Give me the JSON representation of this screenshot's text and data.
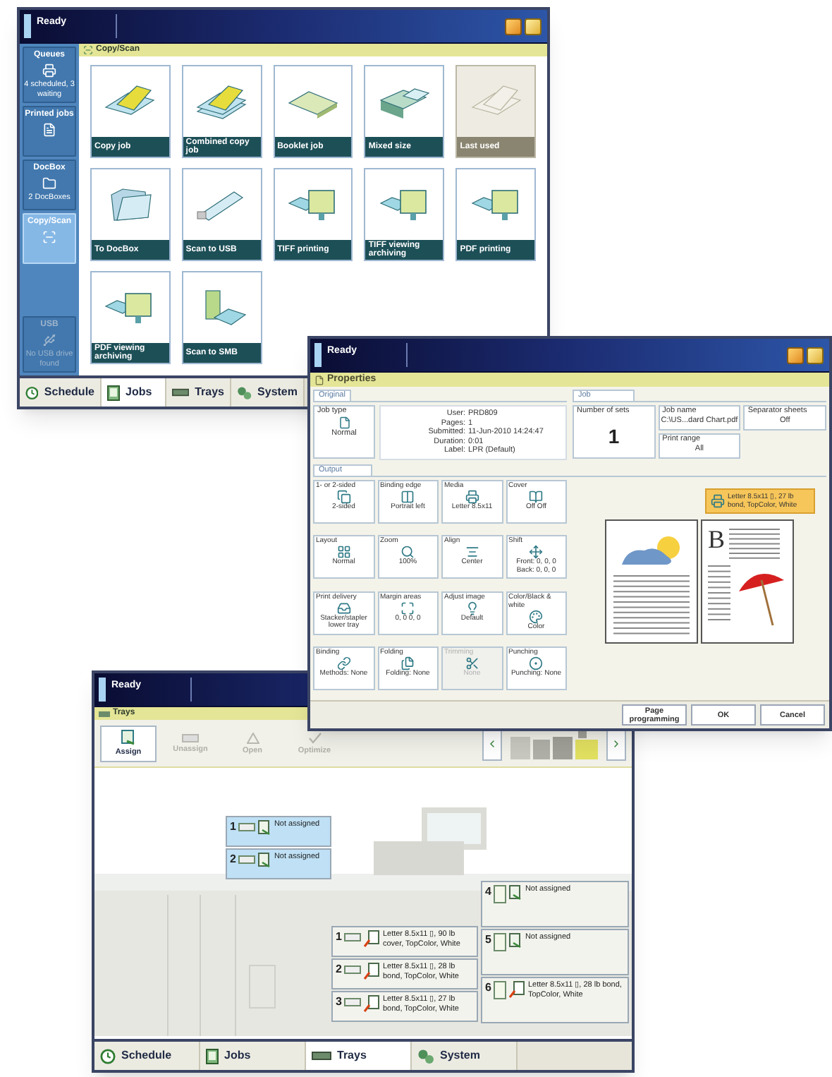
{
  "copy_scan_window": {
    "title": "Ready",
    "sidebar": [
      {
        "label": "Queues",
        "detail": "4 scheduled, 3 waiting",
        "kind": "queues",
        "selected": false,
        "disabled": false
      },
      {
        "label": "Printed jobs",
        "kind": "printed",
        "selected": false,
        "disabled": false
      },
      {
        "label": "DocBox",
        "detail": "2 DocBoxes",
        "kind": "docbox",
        "selected": false,
        "disabled": false
      },
      {
        "label": "Copy/Scan",
        "kind": "copyscan",
        "selected": true,
        "disabled": false
      },
      {
        "label": "USB",
        "detail": "No USB drive found",
        "kind": "usb",
        "selected": false,
        "disabled": true
      }
    ],
    "section_title": "Copy/Scan",
    "tiles": [
      {
        "label": "Copy job",
        "kind": "copy",
        "disabled": false
      },
      {
        "label": "Combined copy job",
        "kind": "combined",
        "disabled": false
      },
      {
        "label": "Booklet job",
        "kind": "booklet",
        "disabled": false
      },
      {
        "label": "Mixed size",
        "kind": "mixed",
        "disabled": false
      },
      {
        "label": "Last used",
        "kind": "copy",
        "disabled": true
      },
      {
        "label": "To DocBox",
        "kind": "folder",
        "disabled": false
      },
      {
        "label": "Scan to USB",
        "kind": "usb",
        "disabled": false
      },
      {
        "label": "TIFF printing",
        "kind": "scan",
        "disabled": false
      },
      {
        "label": "TIFF viewing archiving",
        "kind": "scan",
        "disabled": false
      },
      {
        "label": "PDF printing",
        "kind": "scan",
        "disabled": false
      },
      {
        "label": "PDF viewing archiving",
        "kind": "scan",
        "disabled": false
      },
      {
        "label": "Scan to SMB",
        "kind": "server",
        "disabled": false
      }
    ],
    "tabs": [
      {
        "label": "Schedule",
        "kind": "schedule",
        "selected": false
      },
      {
        "label": "Jobs",
        "kind": "jobs",
        "selected": true
      },
      {
        "label": "Trays",
        "kind": "trays",
        "selected": false
      },
      {
        "label": "System",
        "kind": "system",
        "selected": false
      }
    ]
  },
  "properties_window": {
    "title": "Ready",
    "header": "Properties",
    "original": {
      "tab": "Original",
      "job_type_label": "Job type",
      "job_type_value": "Normal",
      "info": [
        {
          "label": "User:",
          "value": "PRD809"
        },
        {
          "label": "Pages:",
          "value": "1"
        },
        {
          "label": "Submitted:",
          "value": "11-Jun-2010 14:24:47"
        },
        {
          "label": "Duration:",
          "value": "0:01"
        },
        {
          "label": "Label:",
          "value": "LPR (Default)"
        }
      ]
    },
    "job": {
      "tab": "Job",
      "sets": {
        "label": "Number of sets",
        "value": "1"
      },
      "name": {
        "label": "Job name",
        "value": "C:\\US...dard Chart.pdf"
      },
      "range": {
        "label": "Print range",
        "value": "All"
      },
      "separator": {
        "label": "Separator sheets",
        "value": "Off"
      }
    },
    "output": {
      "tab": "Output",
      "settings": [
        {
          "label": "1- or 2-sided",
          "value": "2-sided",
          "kind": "sides",
          "disabled": false
        },
        {
          "label": "Binding edge",
          "value": "Portrait left",
          "kind": "binding_edge",
          "disabled": false
        },
        {
          "label": "Media",
          "value": "Letter 8.5x11",
          "kind": "media",
          "disabled": false
        },
        {
          "label": "Cover",
          "value": "Off Off",
          "kind": "cover",
          "disabled": false
        },
        {
          "label": "Layout",
          "value": "Normal",
          "kind": "layout",
          "disabled": false
        },
        {
          "label": "Zoom",
          "value": "100%",
          "kind": "zoom",
          "disabled": false
        },
        {
          "label": "Align",
          "value": "Center",
          "kind": "align",
          "disabled": false
        },
        {
          "label": "Shift",
          "value": "Front: 0, 0, 0 Back: 0, 0, 0",
          "kind": "shift",
          "disabled": false
        },
        {
          "label": "Print delivery",
          "value": "Stacker/stapler lower tray",
          "kind": "delivery",
          "disabled": false
        },
        {
          "label": "Margin areas",
          "value": "0, 0 0, 0",
          "kind": "margin",
          "disabled": false
        },
        {
          "label": "Adjust image",
          "value": "Default",
          "kind": "adjust",
          "disabled": false
        },
        {
          "label": "Color/Black & white",
          "value": "Color",
          "kind": "color",
          "disabled": false
        },
        {
          "label": "Binding",
          "value": "Methods: None",
          "kind": "binding",
          "disabled": false
        },
        {
          "label": "Folding",
          "value": "Folding: None",
          "kind": "folding",
          "disabled": false
        },
        {
          "label": "Trimming",
          "value": "None",
          "kind": "trimming",
          "disabled": true
        },
        {
          "label": "Punching",
          "value": "Punching: None",
          "kind": "punching",
          "disabled": false
        }
      ],
      "media": "Letter 8.5x11 ▯, 27 lb bond, TopColor, White",
      "preview_letter": "B"
    },
    "buttons": [
      "Page programming",
      "OK",
      "Cancel"
    ]
  },
  "trays_window": {
    "title": "Ready",
    "header": "Trays",
    "tools": [
      {
        "label": "Assign",
        "kind": "assign",
        "selected": true,
        "disabled": false
      },
      {
        "label": "Unassign",
        "kind": "unassign",
        "selected": false,
        "disabled": true
      },
      {
        "label": "Open",
        "kind": "open",
        "selected": false,
        "disabled": true
      },
      {
        "label": "Optimize",
        "kind": "optimize",
        "selected": false,
        "disabled": true
      }
    ],
    "upper_trays": [
      {
        "number": "1",
        "text": "Not assigned",
        "assigned": false
      },
      {
        "number": "2",
        "text": "Not assigned",
        "assigned": false
      }
    ],
    "lower_trays": [
      {
        "number": "1",
        "text": "Letter 8.5x11 ▯, 90 lb cover, TopColor, White",
        "assigned": true
      },
      {
        "number": "2",
        "text": "Letter 8.5x11 ▯, 28 lb bond, TopColor, White",
        "assigned": true
      },
      {
        "number": "3",
        "text": "Letter 8.5x11 ▯, 27 lb bond, TopColor, White",
        "assigned": true
      }
    ],
    "right_trays": [
      {
        "number": "4",
        "text": "Not assigned",
        "assigned": false
      },
      {
        "number": "5",
        "text": "Not assigned",
        "assigned": false
      },
      {
        "number": "6",
        "text": "Letter 8.5x11 ▯, 28 lb bond, TopColor, White",
        "assigned": true
      }
    ],
    "tabs": [
      {
        "label": "Schedule",
        "kind": "schedule",
        "selected": false
      },
      {
        "label": "Jobs",
        "kind": "jobs",
        "selected": false
      },
      {
        "label": "Trays",
        "kind": "trays",
        "selected": true
      },
      {
        "label": "System",
        "kind": "system",
        "selected": false
      }
    ]
  }
}
